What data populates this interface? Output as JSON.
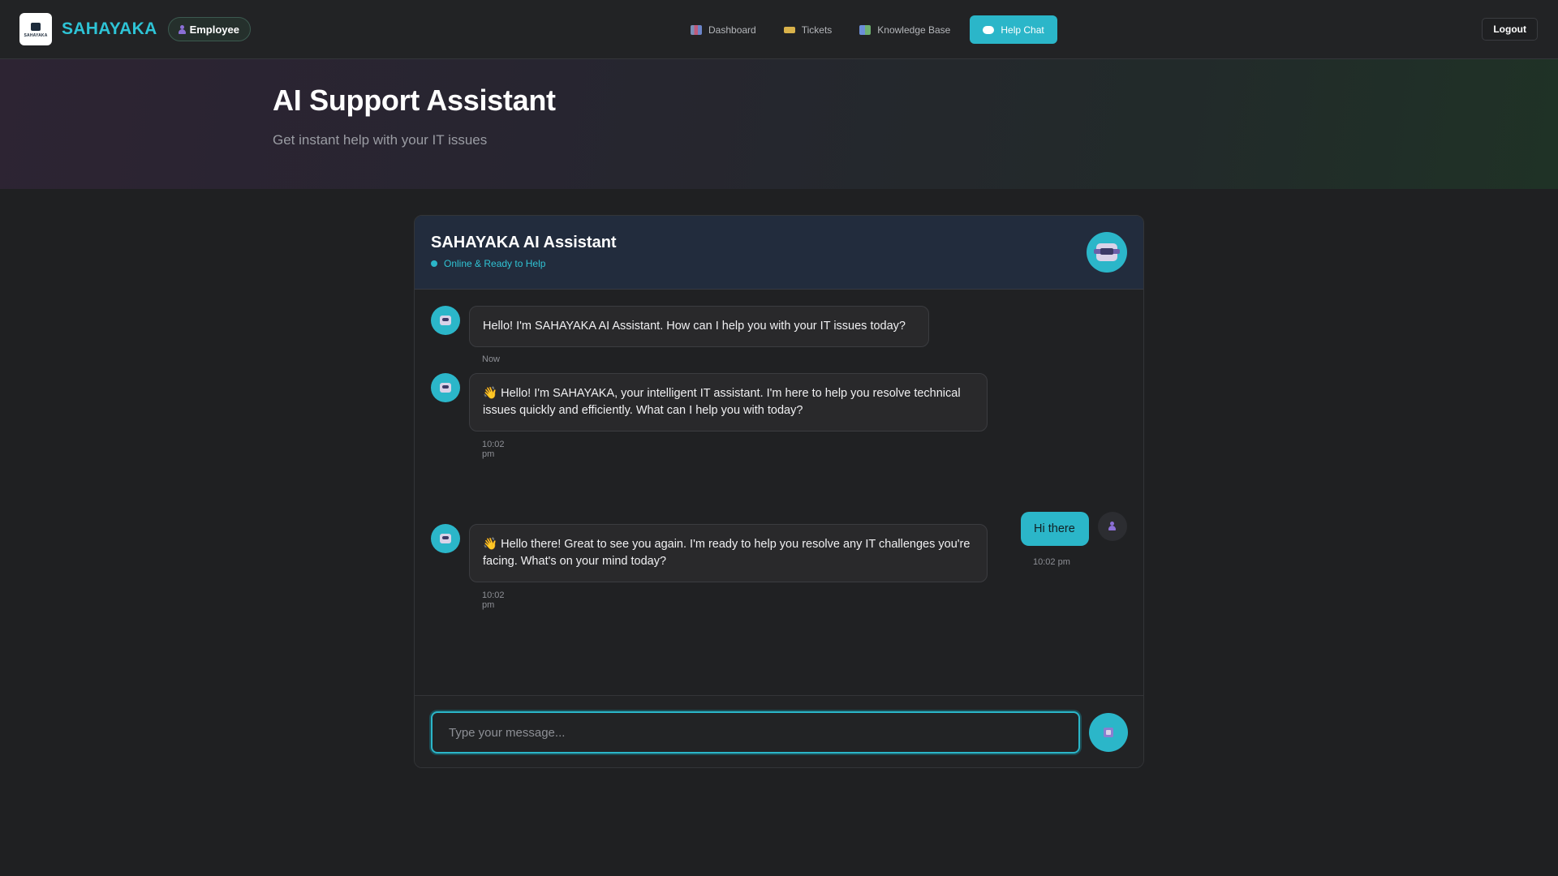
{
  "brand": {
    "name": "SAHAYAKA",
    "logo_text": "SAHAYAKA"
  },
  "role_badge": "Employee",
  "nav": [
    {
      "label": "Dashboard",
      "icon": "dashboard-icon"
    },
    {
      "label": "Tickets",
      "icon": "ticket-icon"
    },
    {
      "label": "Knowledge Base",
      "icon": "books-icon"
    },
    {
      "label": "Help Chat",
      "icon": "chat-bubble-icon",
      "active": true
    }
  ],
  "logout_label": "Logout",
  "hero": {
    "title": "AI Support Assistant",
    "subtitle": "Get instant help with your IT issues"
  },
  "chat": {
    "title": "SAHAYAKA AI Assistant",
    "status": "Online & Ready to Help",
    "messages": [
      {
        "from": "bot",
        "text": "Hello! I'm SAHAYAKA AI Assistant. How can I help you with your IT issues today?",
        "time": "Now"
      },
      {
        "from": "bot",
        "emoji": "👋",
        "text": "Hello! I'm SAHAYAKA, your intelligent IT assistant. I'm here to help you resolve technical issues quickly and efficiently. What can I help you with today?",
        "time": "10:02 pm"
      },
      {
        "from": "user",
        "text": "Hi there",
        "time": "10:02 pm"
      },
      {
        "from": "bot",
        "emoji": "👋",
        "text": "Hello there! Great to see you again. I'm ready to help you resolve any IT challenges you're facing. What's on your mind today?",
        "time": "10:02 pm"
      }
    ],
    "input_placeholder": "Type your message...",
    "input_value": ""
  },
  "colors": {
    "accent": "#2bb6c9",
    "brand_text": "#2ec4d6",
    "background": "#1f2022",
    "chat_header": "#222c3d"
  }
}
